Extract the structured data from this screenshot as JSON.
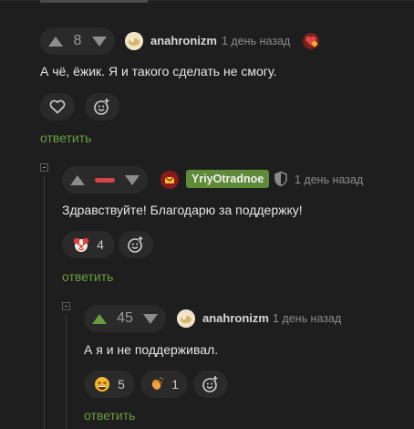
{
  "comments": [
    {
      "score": "8",
      "author": "anahronizm",
      "time": "1 день назад",
      "text": "А чё, ёжик. Я и такого сделать не смогу.",
      "reply_label": "ответить"
    },
    {
      "score": "",
      "author": "YriyOtradnoe",
      "time": "1 день назад",
      "text": "Здравствуйте! Благодарю за поддержку!",
      "reaction_count": "4",
      "reply_label": "ответить"
    },
    {
      "score": "45",
      "author": "anahronizm",
      "time": "1 день назад",
      "text": "А я и не поддерживал.",
      "reactions": [
        {
          "icon": "grinning-squint-emoji",
          "count": "5"
        },
        {
          "icon": "clapping-hands-emoji",
          "count": "1"
        }
      ],
      "reply_label": "ответить"
    }
  ],
  "colors": {
    "background": "#1e1e1e",
    "accent_green": "#6b9c3e",
    "downvote_red": "#d64545"
  }
}
